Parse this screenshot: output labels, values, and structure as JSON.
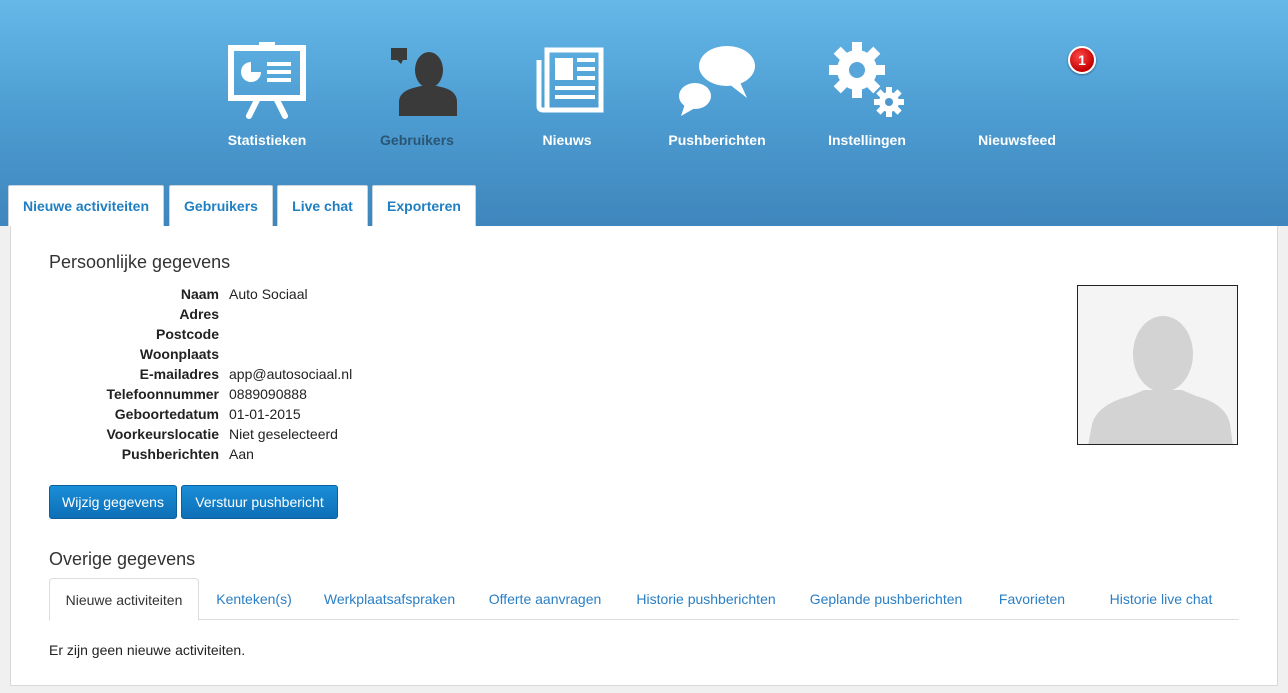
{
  "nav": {
    "items": [
      {
        "label": "Statistieken",
        "icon": "presentation-board-icon"
      },
      {
        "label": "Gebruikers",
        "icon": "user-icon"
      },
      {
        "label": "Nieuws",
        "icon": "newspaper-icon"
      },
      {
        "label": "Pushberichten",
        "icon": "chat-bubbles-icon"
      },
      {
        "label": "Instellingen",
        "icon": "gears-icon"
      },
      {
        "label": "Nieuwsfeed",
        "icon": "feed-icon"
      }
    ],
    "active": "Gebruikers",
    "badge_count": "1"
  },
  "top_tabs": [
    "Nieuwe activiteiten",
    "Gebruikers",
    "Live chat",
    "Exporteren"
  ],
  "personal": {
    "title": "Persoonlijke gegevens",
    "rows": [
      {
        "label": "Naam",
        "value": "Auto Sociaal"
      },
      {
        "label": "Adres",
        "value": ""
      },
      {
        "label": "Postcode",
        "value": ""
      },
      {
        "label": "Woonplaats",
        "value": ""
      },
      {
        "label": "E-mailadres",
        "value": "app@autosociaal.nl"
      },
      {
        "label": "Telefoonnummer",
        "value": "0889090888"
      },
      {
        "label": "Geboortedatum",
        "value": "01-01-2015"
      },
      {
        "label": "Voorkeurslocatie",
        "value": "Niet geselecteerd"
      },
      {
        "label": "Pushberichten",
        "value": "Aan"
      }
    ]
  },
  "buttons": {
    "edit": "Wijzig gegevens",
    "send_push": "Verstuur pushbericht"
  },
  "other": {
    "title": "Overige gegevens",
    "tabs": [
      "Nieuwe activiteiten",
      "Kenteken(s)",
      "Werkplaatsafspraken",
      "Offerte aanvragen",
      "Historie pushberichten",
      "Geplande pushberichten",
      "Favorieten",
      "Historie live chat"
    ],
    "active_tab": "Nieuwe activiteiten",
    "empty_message": "Er zijn geen nieuwe activiteiten."
  },
  "colors": {
    "header_top": "#66b8e8",
    "header_bottom": "#3e86bd",
    "link": "#2a7ec4",
    "button": "#0d6fb6",
    "badge": "#d40000"
  }
}
